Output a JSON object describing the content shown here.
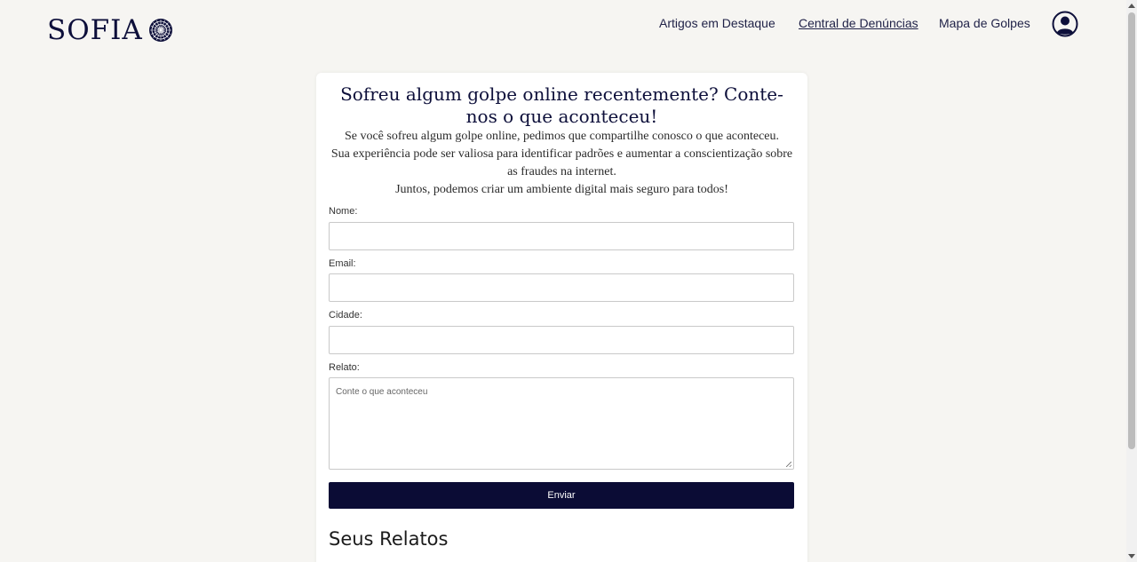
{
  "header": {
    "logo_text": "SOFIA",
    "nav": [
      {
        "label": "Artigos em Destaque",
        "active": false
      },
      {
        "label": "Central de Denúncias",
        "active": true
      },
      {
        "label": "Mapa de Golpes",
        "active": false
      }
    ],
    "user_icon": "user-circle-icon",
    "logo_icon": "mandala-icon"
  },
  "report_form": {
    "title": "Sofreu algum golpe online recentemente? Conte-nos o que aconteceu!",
    "intro_lines": [
      "Se você sofreu algum golpe online, pedimos que compartilhe conosco o que aconteceu.",
      "Sua experiência pode ser valiosa para identificar padrões e aumentar a conscientização sobre as fraudes na internet.",
      "Juntos, podemos criar um ambiente digital mais seguro para todos!"
    ],
    "fields": [
      {
        "label": "Nome:",
        "value": "",
        "placeholder": ""
      },
      {
        "label": "Email:",
        "value": "",
        "placeholder": ""
      },
      {
        "label": "Cidade:",
        "value": "",
        "placeholder": ""
      }
    ],
    "story": {
      "label": "Relato:",
      "value": "",
      "placeholder": "Conte o que aconteceu"
    },
    "submit_label": "Enviar"
  },
  "reports_section": {
    "title": "Seus Relatos"
  },
  "colors": {
    "background": "#f6f5f2",
    "primary": "#0b0c35",
    "text": "#1f2147"
  }
}
